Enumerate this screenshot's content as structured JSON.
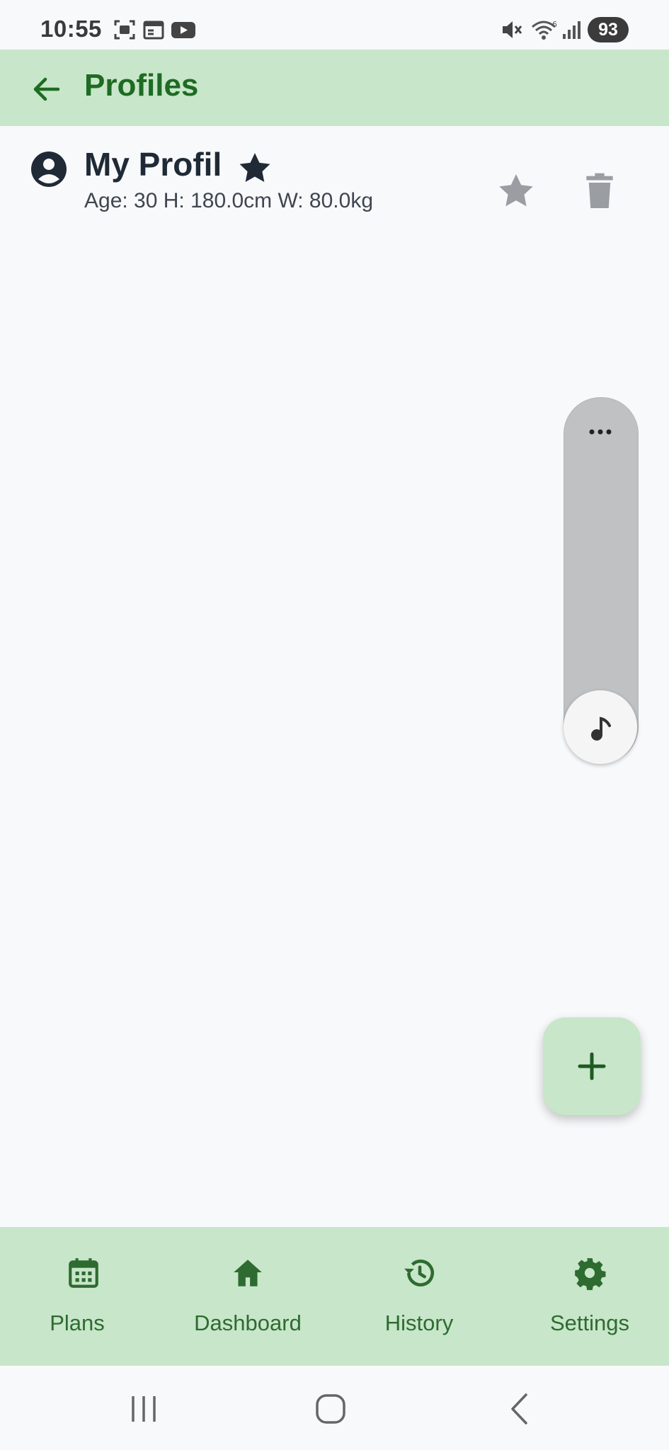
{
  "status_bar": {
    "time": "10:55",
    "battery": "93",
    "icons": [
      "screenshot-icon",
      "calendar-app-icon",
      "youtube-icon",
      "mute-icon",
      "wifi-icon",
      "signal-icon"
    ]
  },
  "app_bar": {
    "title": "Profiles",
    "back_icon": "arrow-left-icon"
  },
  "profile": {
    "name": "My Profil",
    "stats": "Age: 30  H: 180.0cm  W: 80.0kg",
    "is_default": true
  },
  "fab": {
    "icon": "plus-icon"
  },
  "bottom_nav": {
    "items": [
      {
        "label": "Plans",
        "icon": "calendar-icon"
      },
      {
        "label": "Dashboard",
        "icon": "home-icon"
      },
      {
        "label": "History",
        "icon": "history-icon"
      },
      {
        "label": "Settings",
        "icon": "gear-icon"
      }
    ]
  },
  "colors": {
    "accent": "#1e6b23",
    "bar_background": "#c8e6c9",
    "page_background": "#f8f9fb"
  }
}
